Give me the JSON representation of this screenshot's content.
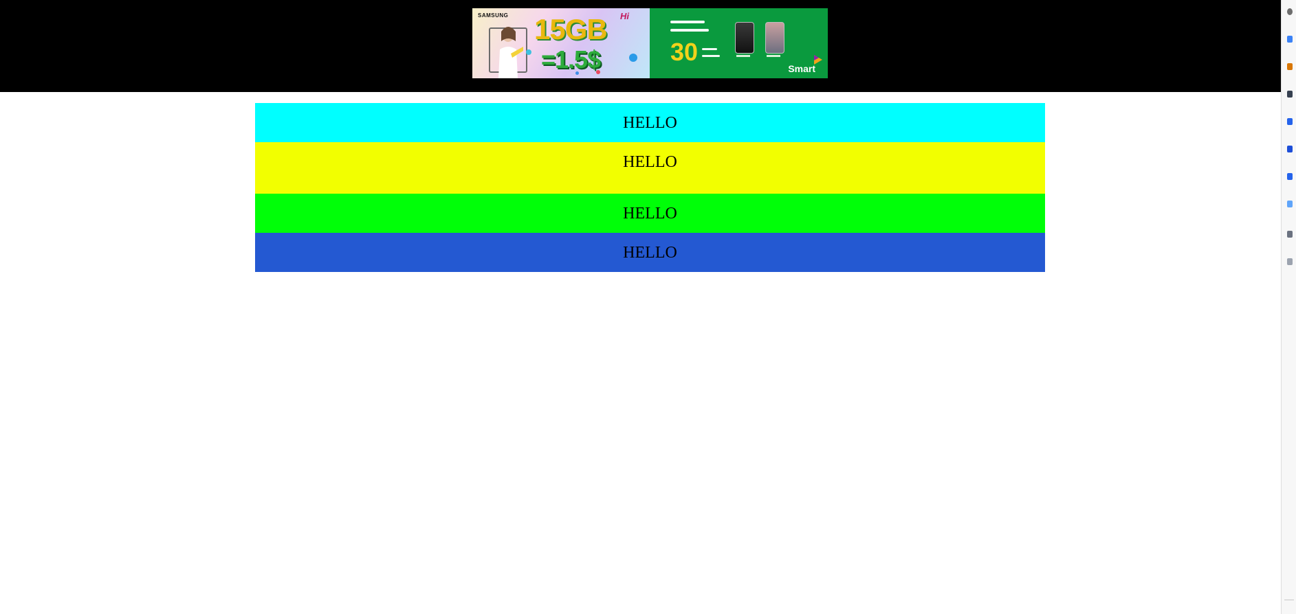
{
  "banner": {
    "brand": "SAMSUNG",
    "data_amount": "15GB",
    "price": "=1.5$",
    "badge": "Hi",
    "days": "30",
    "operator": "Smart",
    "colors": {
      "right_panel": "#0a9a3e",
      "gb_text": "#e9b80f",
      "price_text": "#2eac3c"
    }
  },
  "bands": [
    {
      "label": "HELLO",
      "color": "#00ffff"
    },
    {
      "label": "HELLO",
      "color": "#f2ff00"
    },
    {
      "label": "HELLO",
      "color": "#00ff08"
    },
    {
      "label": "HELLO",
      "color": "#2459d2"
    }
  ],
  "colors": {
    "topbar": "#000000",
    "page_background": "#ffffff"
  },
  "side_rail": {
    "icons": [
      "profile-icon",
      "arrow-icon",
      "bag-icon",
      "puzzle-icon",
      "copy-icon",
      "outlook-icon",
      "chart-icon",
      "send-icon",
      "pin-icon",
      "add-icon"
    ]
  }
}
